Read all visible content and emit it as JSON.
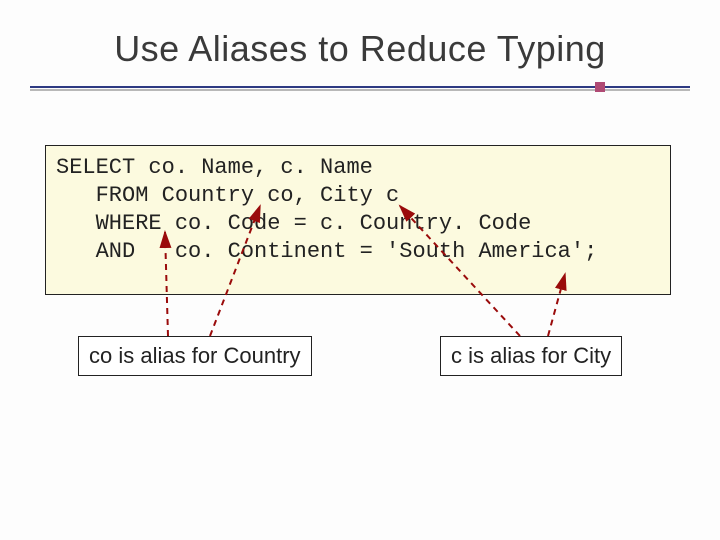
{
  "title": "Use Aliases to Reduce Typing",
  "code": {
    "line1": "SELECT co. Name, c. Name",
    "line2": "   FROM Country co, City c",
    "line3": "   WHERE co. Code = c. Country. Code",
    "line4": "   AND   co. Continent = 'South America';"
  },
  "callouts": {
    "left": "co is alias for Country",
    "right": "c is alias for City"
  },
  "colors": {
    "rule": "#2e3a82",
    "accent": "#b04a74",
    "code_bg": "#fcfadf",
    "arrow": "#9a0b0b"
  }
}
